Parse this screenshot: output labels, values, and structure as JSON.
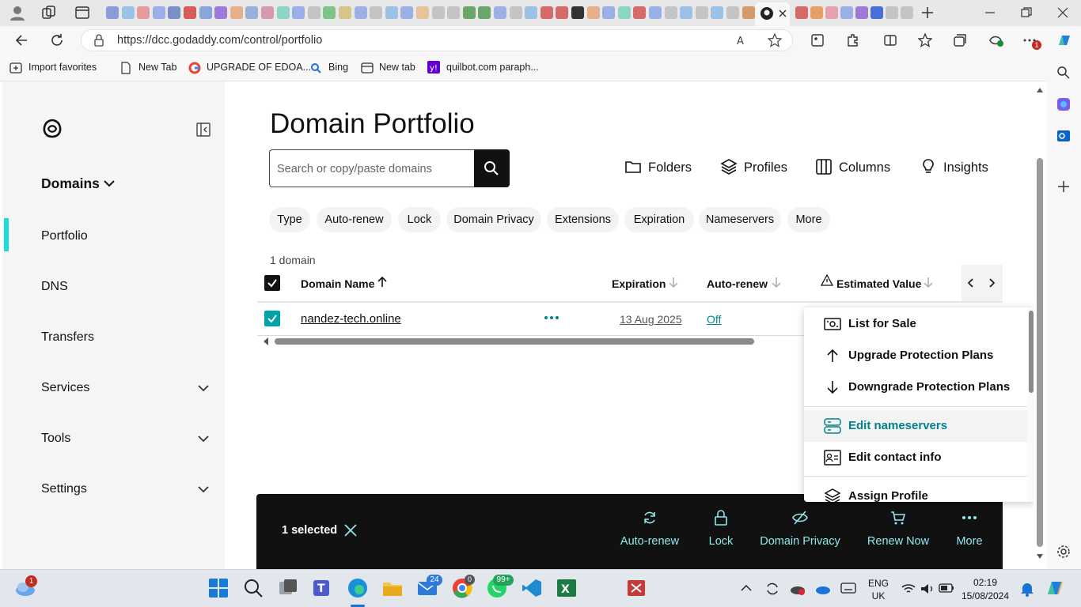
{
  "browser": {
    "url": "https://dcc.godaddy.com/control/portfolio",
    "profile_badge": "1"
  },
  "favorites": [
    {
      "label": "Import favorites",
      "icon": "import-icon"
    },
    {
      "label": "New Tab",
      "icon": "page-icon"
    },
    {
      "label": "UPGRADE OF EDOA...",
      "icon": "google-icon"
    },
    {
      "label": "Bing",
      "icon": "search-icon"
    },
    {
      "label": "New tab",
      "icon": "tab-icon"
    },
    {
      "label": "quilbot.com paraph...",
      "icon": "yahoo-icon"
    }
  ],
  "sidebar": {
    "section": "Domains",
    "items": [
      {
        "label": "Portfolio",
        "active": true,
        "expandable": false
      },
      {
        "label": "DNS",
        "active": false,
        "expandable": false
      },
      {
        "label": "Transfers",
        "active": false,
        "expandable": false
      },
      {
        "label": "Services",
        "active": false,
        "expandable": true
      },
      {
        "label": "Tools",
        "active": false,
        "expandable": true
      },
      {
        "label": "Settings",
        "active": false,
        "expandable": true
      }
    ]
  },
  "main": {
    "title": "Domain Portfolio",
    "search_placeholder": "Search or copy/paste domains",
    "tools": [
      {
        "label": "Folders",
        "icon": "folder-icon"
      },
      {
        "label": "Profiles",
        "icon": "layers-icon"
      },
      {
        "label": "Columns",
        "icon": "columns-icon"
      },
      {
        "label": "Insights",
        "icon": "lightbulb-icon"
      }
    ],
    "filters": [
      "Type",
      "Auto-renew",
      "Lock",
      "Domain Privacy",
      "Extensions",
      "Expiration",
      "Nameservers",
      "More"
    ],
    "count": "1 domain",
    "columns": [
      "Domain Name",
      "Expiration",
      "Auto-renew",
      "Estimated Value"
    ],
    "rows": [
      {
        "domain": "nandez-tech.online",
        "expiration": "13 Aug 2025",
        "auto_renew": "Off",
        "selected": true
      }
    ]
  },
  "menu": {
    "items": [
      {
        "label": "List for Sale",
        "icon": "sale-icon",
        "highlight": false
      },
      {
        "label": "Upgrade Protection Plans",
        "icon": "arrow-up-icon",
        "highlight": false
      },
      {
        "label": "Downgrade Protection Plans",
        "icon": "arrow-down-icon",
        "highlight": false
      },
      {
        "label": "Edit nameservers",
        "icon": "server-icon",
        "highlight": true
      },
      {
        "label": "Edit contact info",
        "icon": "contact-icon",
        "highlight": false
      },
      {
        "label": "Assign Profile",
        "icon": "layers-icon",
        "highlight": false
      }
    ]
  },
  "action_bar": {
    "selected": "1 selected",
    "actions": [
      {
        "label": "Auto-renew",
        "icon": "refresh-icon"
      },
      {
        "label": "Lock",
        "icon": "lock-icon"
      },
      {
        "label": "Domain Privacy",
        "icon": "eye-off-icon"
      },
      {
        "label": "Renew Now",
        "icon": "cart-icon"
      },
      {
        "label": "More",
        "icon": "dots-icon"
      }
    ]
  },
  "taskbar": {
    "weather_badge": "1",
    "mail_badge": "24",
    "chrome_badge": "0",
    "whatsapp_badge": "99+",
    "lang": "ENG",
    "region": "UK",
    "time": "02:19",
    "date": "15/08/2024"
  },
  "colors": {
    "accent_teal": "#1bdbdb",
    "link_teal": "#00838c",
    "action_text": "#8ee9ee",
    "menu_highlight_bg": "#f3f3f3"
  }
}
